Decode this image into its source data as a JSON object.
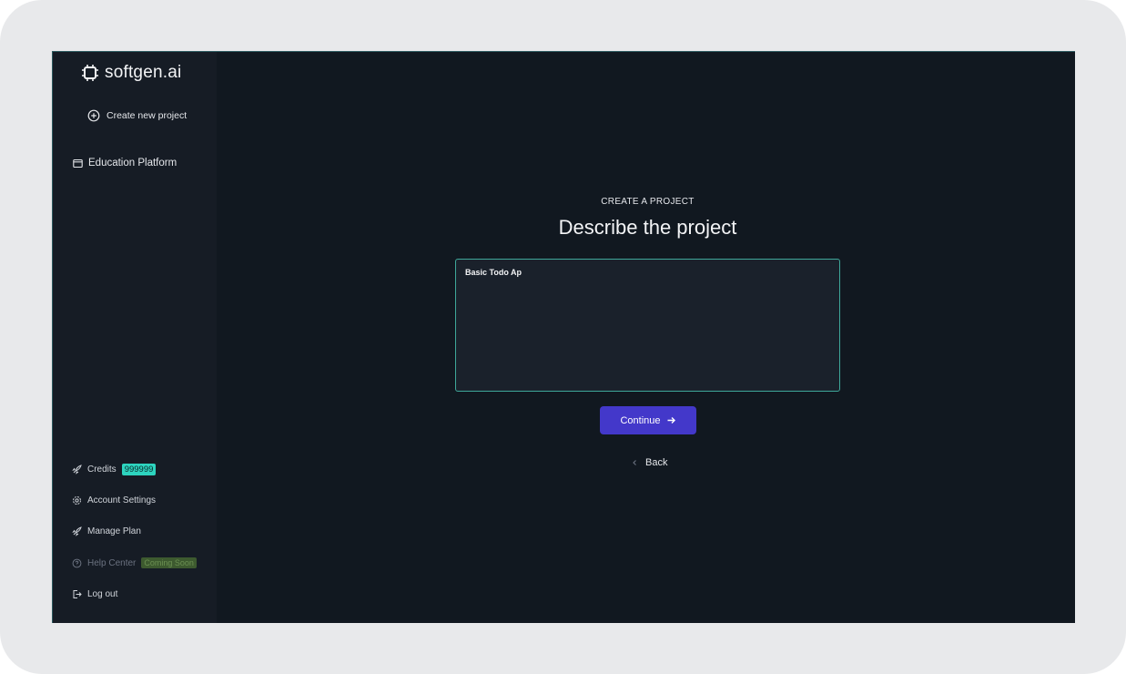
{
  "app": {
    "name": "softgen.ai"
  },
  "sidebar": {
    "create_label": "Create new project",
    "project": "Education Platform",
    "credits_label": "Credits",
    "credits_value": "999999",
    "account_label": "Account Settings",
    "plan_label": "Manage Plan",
    "help_label": "Help Center",
    "help_badge": "Coming Soon",
    "logout_label": "Log out"
  },
  "main": {
    "eyebrow": "CREATE A PROJECT",
    "title": "Describe the project",
    "description_value": "Basic Todo Ap",
    "continue_label": "Continue",
    "back_label": "Back"
  },
  "colors": {
    "accent": "#4338ca",
    "focus": "#3fa89a",
    "credits": "#2dd4bf",
    "bg": "#111820"
  }
}
